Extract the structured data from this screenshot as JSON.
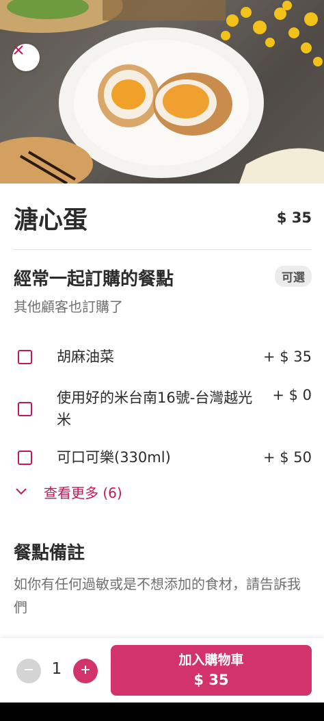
{
  "item": {
    "title": "溏心蛋",
    "price": "$ 35"
  },
  "frequently_bought": {
    "title": "經常一起訂購的餐點",
    "badge": "可選",
    "subtitle": "其他顧客也訂購了",
    "options": [
      {
        "label": "胡麻油菜",
        "price": "+ $ 35"
      },
      {
        "label": "使用好的米台南16號-台灣越光米",
        "price": "+ $ 0"
      },
      {
        "label": "可口可樂(330ml)",
        "price": "+ $ 50"
      }
    ],
    "see_more": "查看更多 (6)"
  },
  "notes": {
    "title": "餐點備註",
    "hint": "如你有任何過敏或是不想添加的食材，請告訴我們"
  },
  "cart": {
    "quantity": "1",
    "add_label": "加入購物車",
    "add_price": "$ 35"
  },
  "icons": {
    "close": "close-icon",
    "chevron": "chevron-down-icon",
    "minus": "minus-icon",
    "plus": "plus-icon"
  },
  "colors": {
    "accent": "#d3336b",
    "checkbox": "#c2185b",
    "muted": "#707070"
  }
}
